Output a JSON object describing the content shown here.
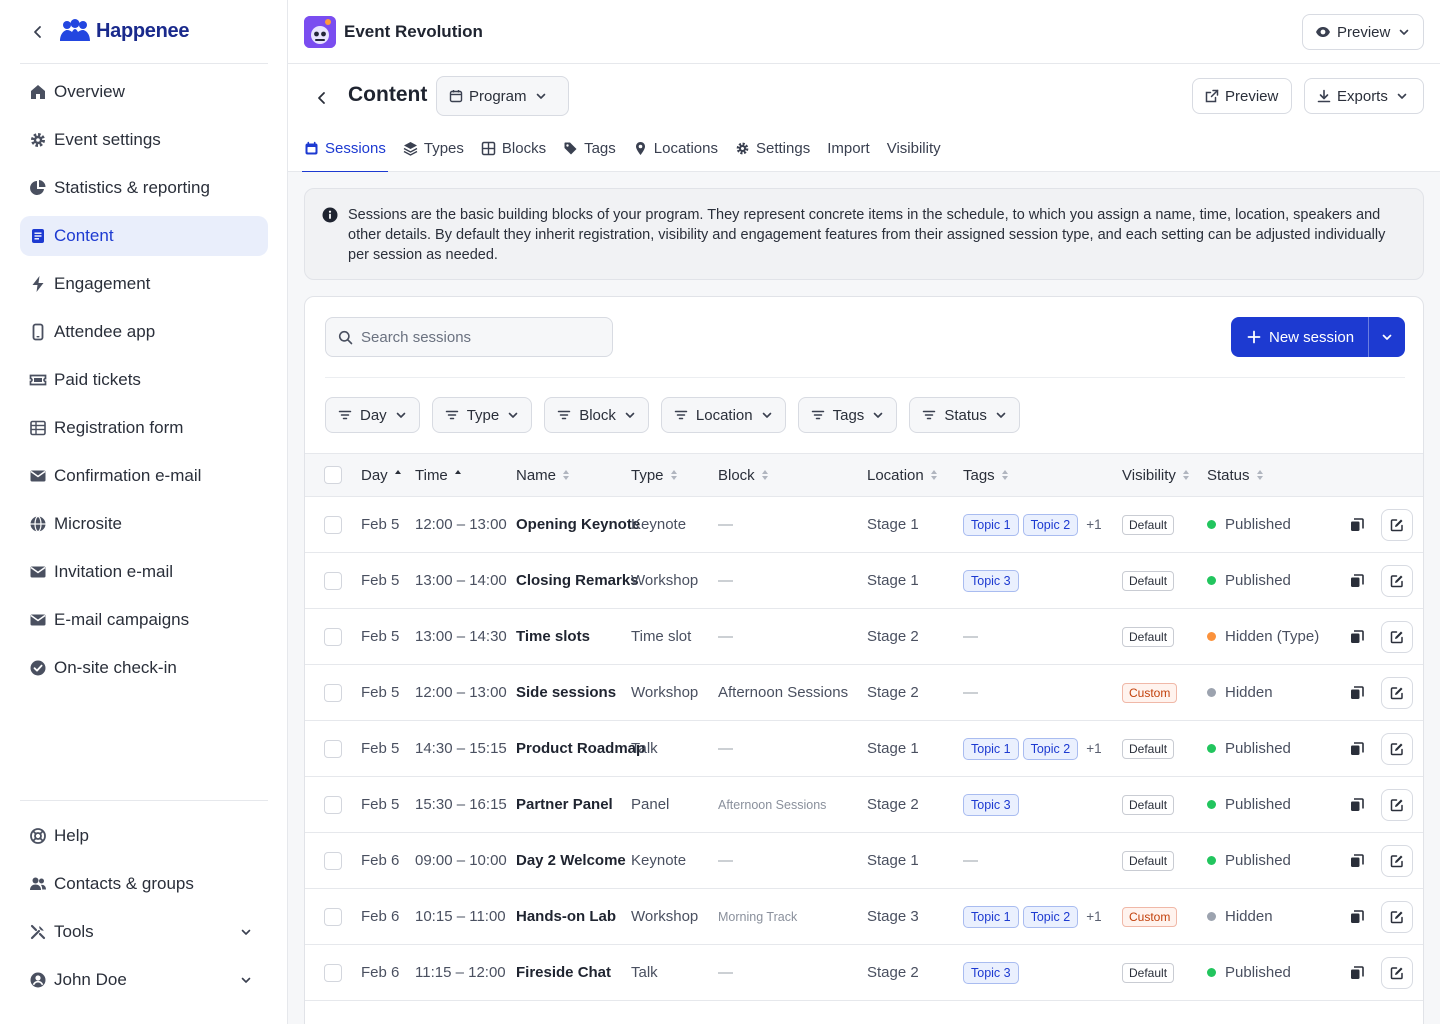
{
  "brand": {
    "name": "Happenee"
  },
  "sidebar": {
    "items": [
      {
        "label": "Overview",
        "icon": "home-icon"
      },
      {
        "label": "Event settings",
        "icon": "gear-icon"
      },
      {
        "label": "Statistics & reporting",
        "icon": "pie-chart-icon"
      },
      {
        "label": "Content",
        "icon": "document-icon",
        "active": true
      },
      {
        "label": "Engagement",
        "icon": "bolt-icon"
      },
      {
        "label": "Attendee app",
        "icon": "phone-icon"
      },
      {
        "label": "Paid tickets",
        "icon": "ticket-icon"
      },
      {
        "label": "Registration form",
        "icon": "table-icon"
      },
      {
        "label": "Confirmation e-mail",
        "icon": "mail-icon"
      },
      {
        "label": "Microsite",
        "icon": "globe-icon"
      },
      {
        "label": "Invitation e-mail",
        "icon": "mail-icon"
      },
      {
        "label": "E-mail campaigns",
        "icon": "mail-icon"
      },
      {
        "label": "On-site check-in",
        "icon": "check-circle-icon"
      }
    ],
    "bottom": [
      {
        "label": "Help",
        "icon": "lifebuoy-icon"
      },
      {
        "label": "Contacts & groups",
        "icon": "users-icon"
      },
      {
        "label": "Tools",
        "icon": "tools-icon"
      },
      {
        "label": "John Doe",
        "icon": "user-circle-icon"
      }
    ]
  },
  "topbar": {
    "event_name": "Event Revolution",
    "preview_label": "Preview"
  },
  "page": {
    "title": "Content",
    "program_label": "Program",
    "preview_label": "Preview",
    "exports_label": "Exports",
    "tabs": [
      {
        "label": "Sessions",
        "icon": "calendar-icon",
        "active": true
      },
      {
        "label": "Types",
        "icon": "layers-icon"
      },
      {
        "label": "Blocks",
        "icon": "grid-icon"
      },
      {
        "label": "Tags",
        "icon": "tag-icon"
      },
      {
        "label": "Locations",
        "icon": "pin-icon"
      },
      {
        "label": "Settings",
        "icon": "gear-icon"
      },
      {
        "label": "Import",
        "icon": ""
      },
      {
        "label": "Visibility",
        "icon": ""
      }
    ]
  },
  "info": {
    "text": "Sessions are the basic building blocks of your program. They represent concrete items in the schedule, to which you assign a name, time, location, speakers and other details. By default they inherit registration, visibility and engagement features from their assigned session type, and each setting can be adjusted individually per session as needed."
  },
  "toolbar": {
    "search_placeholder": "Search sessions",
    "new_session_label": "New session",
    "filters": [
      "Day",
      "Type",
      "Block",
      "Location",
      "Tags",
      "Status"
    ]
  },
  "table": {
    "columns": [
      "Day",
      "Time",
      "Name",
      "Type",
      "Block",
      "Location",
      "Tags",
      "Visibility",
      "Status"
    ],
    "rows": [
      {
        "day": "Feb 5",
        "time": "12:00 – 13:00",
        "name": "Opening Keynote",
        "type": "Keynote",
        "block": "—",
        "location": "Stage 1",
        "tags": [
          "Topic 1",
          "Topic 2"
        ],
        "tags_more": "+1",
        "visibility": "Default",
        "status": "Published"
      },
      {
        "day": "Feb 5",
        "time": "13:00 – 14:00",
        "name": "Closing Remarks",
        "type": "Workshop",
        "block": "—",
        "location": "Stage 1",
        "tags": [
          "Topic 3"
        ],
        "tags_more": "",
        "visibility": "Default",
        "status": "Published"
      },
      {
        "day": "Feb 5",
        "time": "13:00 – 14:30",
        "name": "Time slots",
        "type": "Time slot",
        "block": "—",
        "location": "Stage 2",
        "tags": [],
        "tags_more": "",
        "visibility": "Default",
        "status": "Hidden (Type)"
      },
      {
        "day": "Feb 5",
        "time": "12:00 – 13:00",
        "name": "Side sessions",
        "type": "Workshop",
        "block": "Afternoon Sessions",
        "location": "Stage 2",
        "tags": [],
        "tags_more": "",
        "visibility": "Custom",
        "status": "Hidden"
      },
      {
        "day": "Feb 5",
        "time": "14:30 – 15:15",
        "name": "Product Roadmap",
        "type": "Talk",
        "block": "—",
        "location": "Stage 1",
        "tags": [
          "Topic 1",
          "Topic 2"
        ],
        "tags_more": "+1",
        "visibility": "Default",
        "status": "Published"
      },
      {
        "day": "Feb 5",
        "time": "15:30 – 16:15",
        "name": "Partner Panel",
        "type": "Panel",
        "block": "Afternoon Sessions",
        "block_small": true,
        "location": "Stage 2",
        "tags": [
          "Topic 3"
        ],
        "tags_more": "",
        "visibility": "Default",
        "status": "Published"
      },
      {
        "day": "Feb 6",
        "time": "09:00 – 10:00",
        "name": "Day 2 Welcome",
        "type": "Keynote",
        "block": "—",
        "location": "Stage 1",
        "tags": [],
        "tags_more": "",
        "visibility": "Default",
        "status": "Published"
      },
      {
        "day": "Feb 6",
        "time": "10:15 – 11:00",
        "name": "Hands-on Lab",
        "type": "Workshop",
        "block": "Morning Track",
        "block_small": true,
        "location": "Stage 3",
        "tags": [
          "Topic 1",
          "Topic 2"
        ],
        "tags_more": "+1",
        "visibility": "Custom",
        "status": "Hidden"
      },
      {
        "day": "Feb 6",
        "time": "11:15 – 12:00",
        "name": "Fireside Chat",
        "type": "Talk",
        "block": "—",
        "location": "Stage 2",
        "tags": [
          "Topic 3"
        ],
        "tags_more": "",
        "visibility": "Default",
        "status": "Published"
      }
    ]
  },
  "colors": {
    "accent": "#1d3ad1",
    "published": "#22c55e",
    "hidden_type": "#fb923c",
    "hidden": "#9ca3af"
  }
}
